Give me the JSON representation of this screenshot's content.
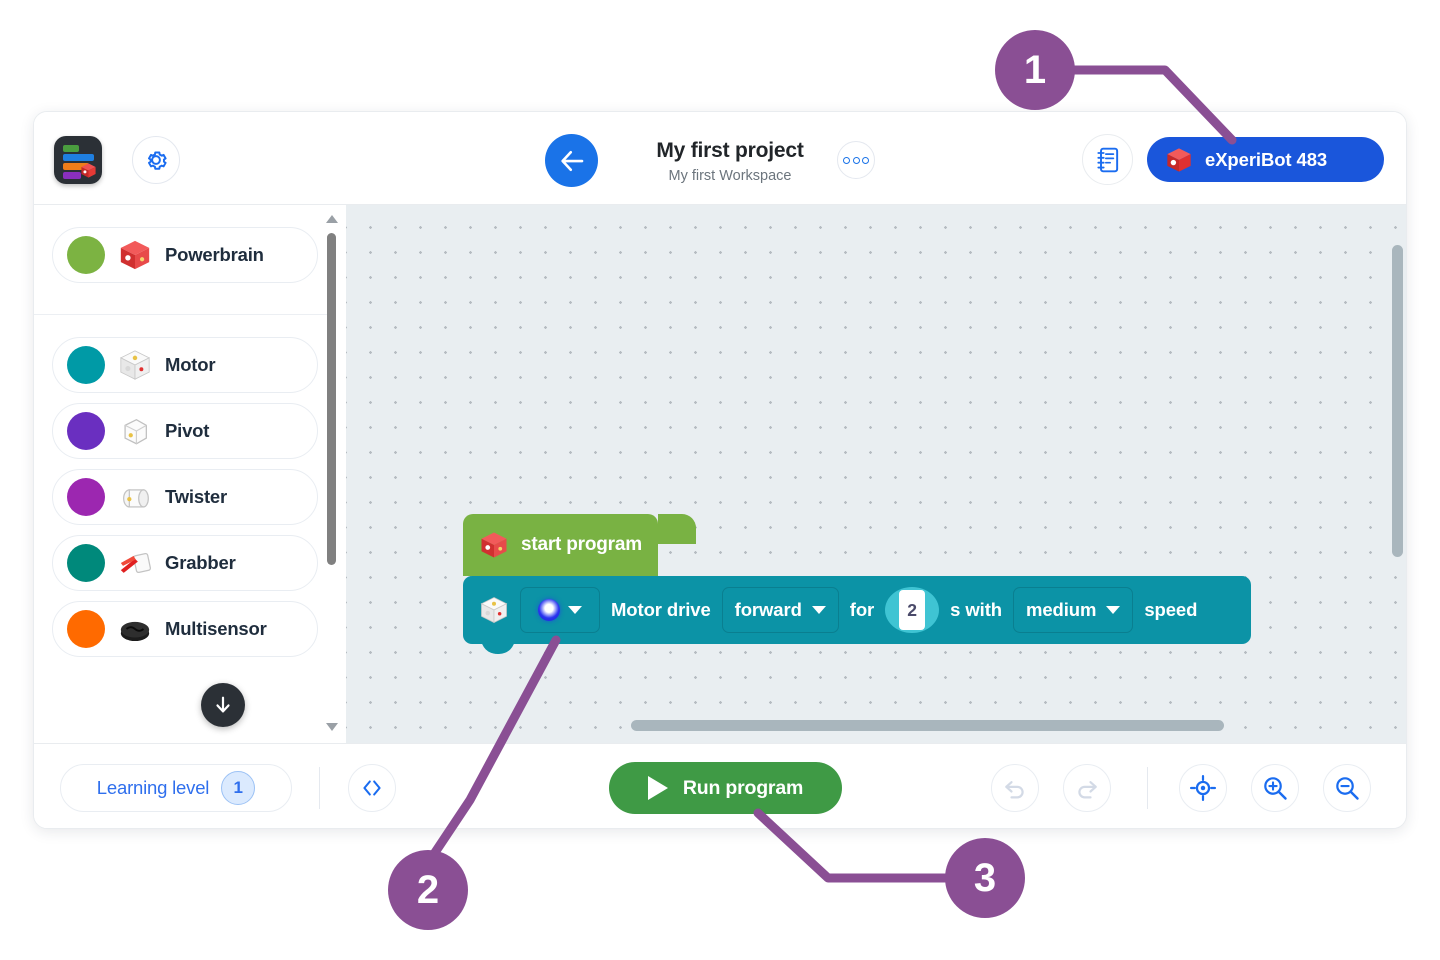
{
  "header": {
    "logo_icon": "app-logo-blocks-cube-icon",
    "settings_icon": "gear-icon",
    "back_icon": "arrow-left-icon",
    "project_title": "My first project",
    "workspace_name": "My first Workspace",
    "more_icon": "three-dots-icon",
    "notes_icon": "notebook-icon",
    "device_icon": "red-cube-icon",
    "device_name": "eXperiBot 483",
    "device_button_color": "#1a56db"
  },
  "sidebar": {
    "groups": [
      {
        "items": [
          {
            "label": "Powerbrain",
            "color": "#7cb342",
            "thumb_icon": "powerbrain-cube-icon"
          }
        ]
      },
      {
        "items": [
          {
            "label": "Motor",
            "color": "#009aa6",
            "thumb_icon": "motor-cube-icon"
          },
          {
            "label": "Pivot",
            "color": "#6a2fc0",
            "thumb_icon": "pivot-module-icon"
          },
          {
            "label": "Twister",
            "color": "#9c27b0",
            "thumb_icon": "twister-module-icon"
          },
          {
            "label": "Grabber",
            "color": "#00897b",
            "thumb_icon": "grabber-module-icon"
          },
          {
            "label": "Multisensor",
            "color": "#ff6a00",
            "thumb_icon": "multisensor-disc-icon"
          }
        ]
      }
    ],
    "scroll_down_icon": "arrow-down-icon",
    "scroll_up_arrow_icon": "scroll-up-arrow-icon",
    "scroll_down_arrow_icon": "scroll-down-arrow-icon"
  },
  "canvas": {
    "blocks": [
      {
        "type": "start",
        "icon": "powerbrain-cube-icon",
        "label": "start program",
        "color": "#79b243"
      },
      {
        "type": "motor-drive",
        "icon": "motor-cube-icon",
        "color": "#0c93a6",
        "port_value": "led-blue",
        "text_1": "Motor drive",
        "direction_value": "forward",
        "text_2": "for",
        "duration_value": "2",
        "text_3": "s with",
        "speed_value": "medium",
        "text_4": "speed"
      }
    ]
  },
  "footer": {
    "learning_level_label": "Learning level",
    "learning_level_value": "1",
    "code_view_icon": "code-brackets-icon",
    "run_label": "Run program",
    "run_icon": "play-triangle-icon",
    "run_button_color": "#3f9a45",
    "undo_icon": "undo-arrow-icon",
    "redo_icon": "redo-arrow-icon",
    "center_icon": "center-target-icon",
    "zoom_in_icon": "zoom-in-icon",
    "zoom_out_icon": "zoom-out-icon"
  },
  "callouts": [
    {
      "number": "1",
      "target": "device-button"
    },
    {
      "number": "2",
      "target": "motor-block-port-field"
    },
    {
      "number": "3",
      "target": "run-program-button"
    }
  ],
  "colors": {
    "callout": "#8a4f94",
    "accent_blue": "#1a73e8",
    "canvas_bg": "#e9eef1"
  }
}
